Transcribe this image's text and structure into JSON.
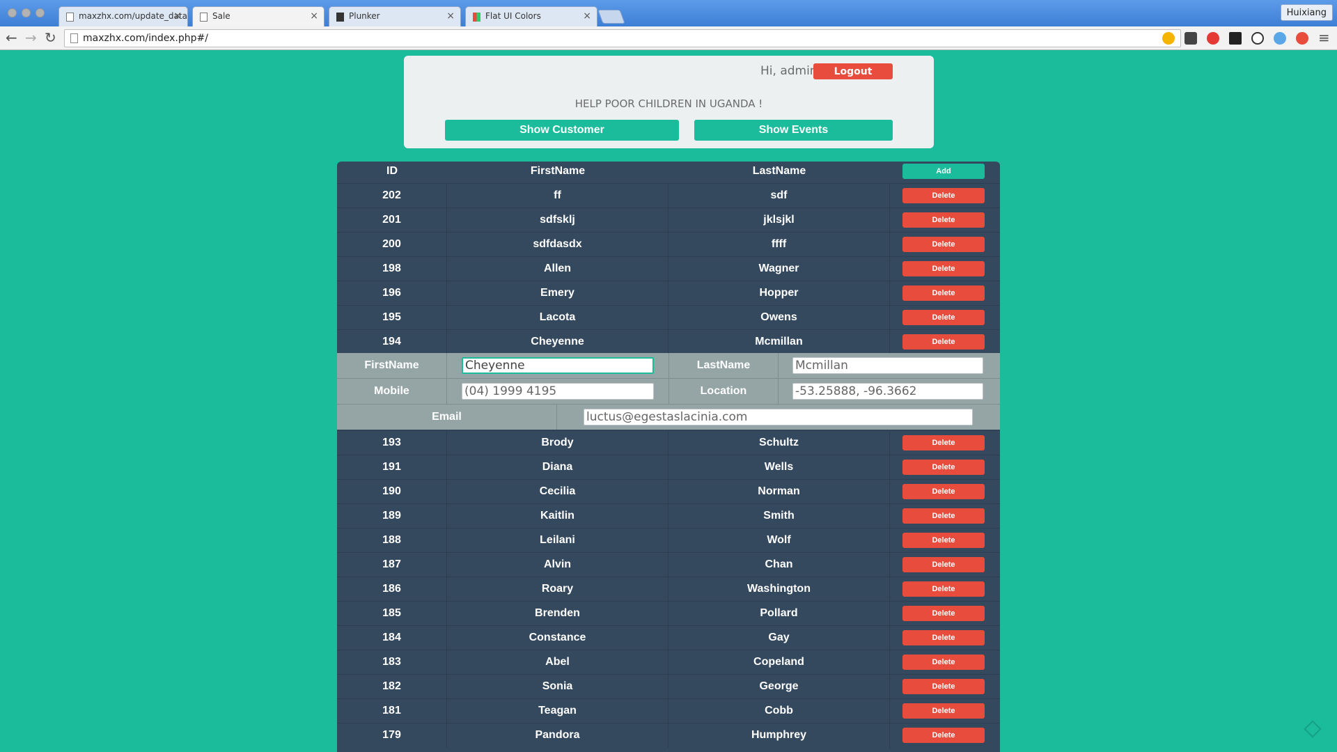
{
  "browser": {
    "tabs": [
      {
        "title": "maxzhx.com/update_data",
        "active": false,
        "icon": "page-icon"
      },
      {
        "title": "Sale",
        "active": true,
        "icon": "page-icon"
      },
      {
        "title": "Plunker",
        "active": false,
        "icon": "plunker-icon"
      },
      {
        "title": "Flat UI Colors",
        "active": false,
        "icon": "flat-ui-icon"
      }
    ],
    "tab_close": "×",
    "profile_name": "Huixiang",
    "url": "maxzhx.com/index.php#/",
    "nav": {
      "back": "←",
      "forward": "→",
      "reload": "↻",
      "star": "☆",
      "menu": "≡"
    }
  },
  "header": {
    "greeting": "Hi, admin",
    "logout_label": "Logout",
    "slogan": "HELP POOR CHILDREN IN UGANDA !",
    "show_customer_label": "Show Customer",
    "show_events_label": "Show Events"
  },
  "table": {
    "columns": {
      "id": "ID",
      "first": "FirstName",
      "last": "LastName"
    },
    "add_label": "Add",
    "delete_label": "Delete",
    "rows_top": [
      {
        "id": "202",
        "first": "ff",
        "last": "sdf"
      },
      {
        "id": "201",
        "first": "sdfsklj",
        "last": "jklsjkl"
      },
      {
        "id": "200",
        "first": "sdfdasdx",
        "last": "ffff"
      },
      {
        "id": "198",
        "first": "Allen",
        "last": "Wagner"
      },
      {
        "id": "196",
        "first": "Emery",
        "last": "Hopper"
      },
      {
        "id": "195",
        "first": "Lacota",
        "last": "Owens"
      },
      {
        "id": "194",
        "first": "Cheyenne",
        "last": "Mcmillan"
      }
    ],
    "edit": {
      "firstname_label": "FirstName",
      "firstname_value": "Cheyenne",
      "lastname_label": "LastName",
      "lastname_value": "Mcmillan",
      "mobile_label": "Mobile",
      "mobile_value": "(04) 1999 4195",
      "location_label": "Location",
      "location_value": "-53.25888, -96.3662",
      "email_label": "Email",
      "email_value": "luctus@egestaslacinia.com"
    },
    "rows_bottom": [
      {
        "id": "193",
        "first": "Brody",
        "last": "Schultz"
      },
      {
        "id": "191",
        "first": "Diana",
        "last": "Wells"
      },
      {
        "id": "190",
        "first": "Cecilia",
        "last": "Norman"
      },
      {
        "id": "189",
        "first": "Kaitlin",
        "last": "Smith"
      },
      {
        "id": "188",
        "first": "Leilani",
        "last": "Wolf"
      },
      {
        "id": "187",
        "first": "Alvin",
        "last": "Chan"
      },
      {
        "id": "186",
        "first": "Roary",
        "last": "Washington"
      },
      {
        "id": "185",
        "first": "Brenden",
        "last": "Pollard"
      },
      {
        "id": "184",
        "first": "Constance",
        "last": "Gay"
      },
      {
        "id": "183",
        "first": "Abel",
        "last": "Copeland"
      },
      {
        "id": "182",
        "first": "Sonia",
        "last": "George"
      },
      {
        "id": "181",
        "first": "Teagan",
        "last": "Cobb"
      },
      {
        "id": "179",
        "first": "Pandora",
        "last": "Humphrey"
      }
    ]
  },
  "colors": {
    "page_bg": "#1abc9c",
    "table_bg": "#34495e",
    "edit_bg": "#95a5a6",
    "danger": "#e74c3c",
    "card_bg": "#ecf0f1"
  }
}
